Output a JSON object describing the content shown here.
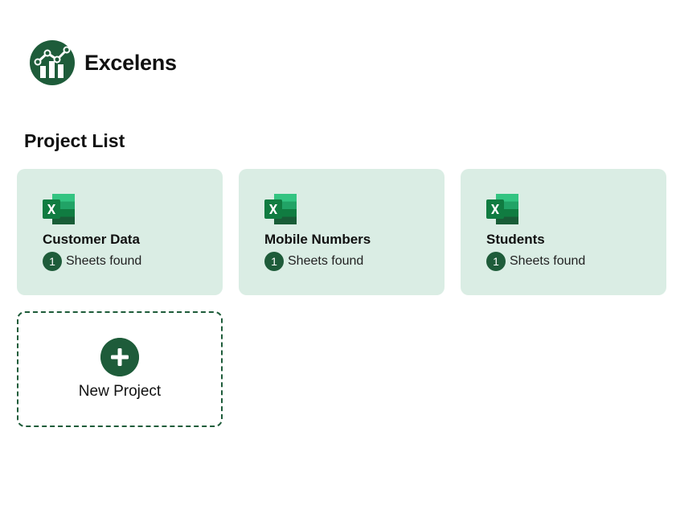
{
  "brand": {
    "name": "Excelens",
    "logo_icon": "excelens-logo-icon",
    "color": "#1e5c3a"
  },
  "section": {
    "title": "Project List"
  },
  "projects": [
    {
      "name": "Customer Data",
      "sheet_count": "1",
      "sheets_label": "Sheets found",
      "icon": "excel-icon"
    },
    {
      "name": "Mobile Numbers",
      "sheet_count": "1",
      "sheets_label": "Sheets found",
      "icon": "excel-icon"
    },
    {
      "name": "Students",
      "sheet_count": "1",
      "sheets_label": "Sheets found",
      "icon": "excel-icon"
    }
  ],
  "new_project": {
    "label": "New Project",
    "icon": "plus-icon"
  },
  "colors": {
    "card_bg": "#daede4",
    "accent": "#1e5c3a"
  }
}
